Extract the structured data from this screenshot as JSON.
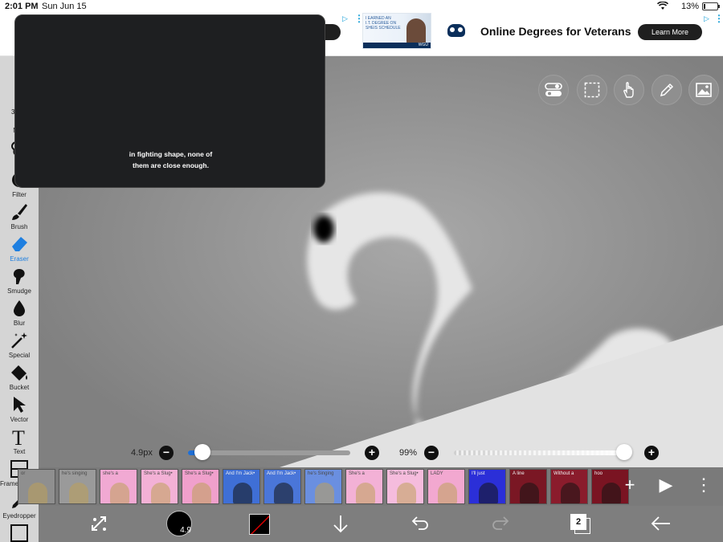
{
  "status_bar": {
    "time": "2:01 PM",
    "date": "Sun Jun 15",
    "battery": "13%",
    "battery_level": 0.13
  },
  "ad": {
    "thumb_text_1": "I EARNED AN\nI.T. DEGREE ON\nMY SCHEDULE",
    "thumb_text_2": "I EARNED AN\nI.T. DEGREE ON\nSHEIS SCHEDULE",
    "thumb_brand": "WGU",
    "title": "Online Degrees for Veterans",
    "cta": "Learn More",
    "cta_left": "re"
  },
  "video": {
    "caption_line1": "in fighting shape, none of",
    "caption_line2": "them are close enough."
  },
  "left_tools": [
    {
      "name": "transform",
      "label": "Tra"
    },
    {
      "name": "magic-wand",
      "label": "Mag"
    },
    {
      "name": "lasso",
      "label": "L"
    },
    {
      "name": "filter",
      "label": "Filter"
    },
    {
      "name": "brush",
      "label": "Brush"
    },
    {
      "name": "eraser",
      "label": "Eraser"
    },
    {
      "name": "smudge",
      "label": "Smudge"
    },
    {
      "name": "blur",
      "label": "Blur"
    },
    {
      "name": "special",
      "label": "Special"
    },
    {
      "name": "bucket",
      "label": "Bucket"
    },
    {
      "name": "vector",
      "label": "Vector"
    },
    {
      "name": "text",
      "label": "Text"
    },
    {
      "name": "frame-divider",
      "label": "Frame Divider"
    },
    {
      "name": "eyedropper",
      "label": "Eyedropper"
    }
  ],
  "brush_size": {
    "label": "4.9px",
    "value": 4.9,
    "slider_fraction": 0.09
  },
  "opacity": {
    "label": "99%",
    "value": 99
  },
  "frames": [
    {
      "text": "or",
      "bg": "#8f8f8f"
    },
    {
      "text": "he's singing",
      "bg": "#9a9a9a"
    },
    {
      "text": "she's a",
      "bg": "#f1a9d3"
    },
    {
      "text": "She's a Slug•",
      "bg": "#f3b1d6"
    },
    {
      "text": "She's a Slug•",
      "bg": "#f0a0cc"
    },
    {
      "text": "And I'm Jack•",
      "bg": "#3f6fd6"
    },
    {
      "text": "And I'm Jack•",
      "bg": "#4a76d9"
    },
    {
      "text": "he's Singing",
      "bg": "#6a8fe0"
    },
    {
      "text": "She's a",
      "bg": "#f3b1d6"
    },
    {
      "text": "She's a Slug•",
      "bg": "#f5bcdd"
    },
    {
      "text": "LADY",
      "bg": "#f2a8d0"
    },
    {
      "text": "I'll just",
      "bg": "#2b2fd8"
    },
    {
      "text": "A line",
      "bg": "#7a1724"
    },
    {
      "text": "Without a",
      "bg": "#8a1c2c"
    },
    {
      "text": "hoo",
      "bg": "#7a1422"
    }
  ],
  "frame_controls": {
    "add": "+",
    "play": "▶",
    "more": "⋮"
  },
  "bottom_bar": {
    "brush_size_badge": "4.9",
    "layers_count": "2"
  },
  "colors": {
    "accent": "#1e7fe0",
    "canvas_bg": "#8a8a8a",
    "toolbar_bg": "#d5d5d5"
  }
}
